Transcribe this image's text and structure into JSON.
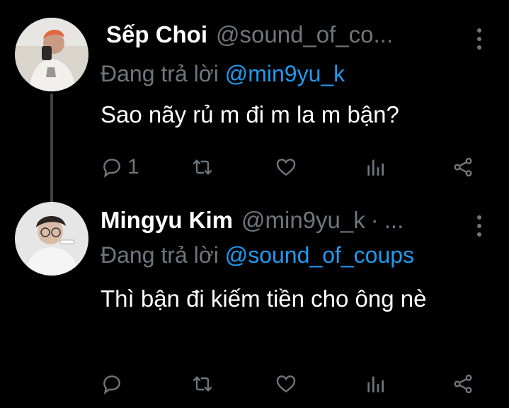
{
  "reply_prefix": "Đang trả lời",
  "tweets": [
    {
      "display_name": "Sếp Choi",
      "handle": "@sound_of_co...",
      "reply_to": "@min9yu_k",
      "text": "Sao nãy rủ m đi m la m bận?",
      "reply_count": "1"
    },
    {
      "display_name": "Mingyu Kim",
      "handle": "@min9yu_k",
      "separator": "·",
      "ellipsis": "...",
      "reply_to": "@sound_of_coups",
      "text": "Thì bận đi kiếm tiền cho ông nè",
      "reply_count": ""
    }
  ],
  "colors": {
    "background": "#000000",
    "text": "#ffffff",
    "muted": "#6e767d",
    "link": "#1d9bf0"
  },
  "icons": [
    "reply-icon",
    "retweet-icon",
    "like-icon",
    "stats-icon",
    "share-icon",
    "more-icon"
  ]
}
